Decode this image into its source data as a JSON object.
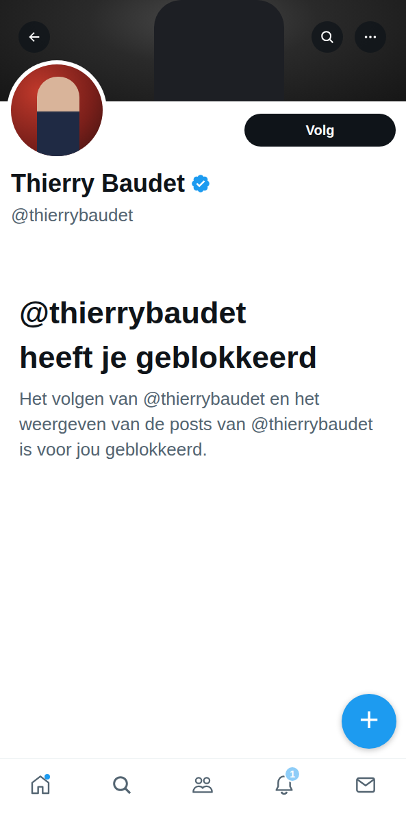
{
  "profile": {
    "name": "Thierry Baudet",
    "verified": true,
    "handle": "@thierrybaudet",
    "follow_button": "Volg"
  },
  "blocked": {
    "title_lines": [
      "@thierrybaudet",
      "heeft je geblokkeerd"
    ],
    "description": "Het volgen van @thierrybaudet en het weergeven van de posts van @thierrybaudet is voor jou geblokkeerd."
  },
  "fab": {
    "label": "+"
  },
  "nav": [
    {
      "kind": "home",
      "selected": false,
      "dot": true,
      "badge": ""
    },
    {
      "kind": "search",
      "selected": false,
      "dot": false,
      "badge": ""
    },
    {
      "kind": "communities",
      "selected": false,
      "dot": false,
      "badge": ""
    },
    {
      "kind": "notifications",
      "selected": false,
      "dot": false,
      "badge": "1"
    },
    {
      "kind": "messages",
      "selected": false,
      "dot": false,
      "badge": ""
    }
  ]
}
